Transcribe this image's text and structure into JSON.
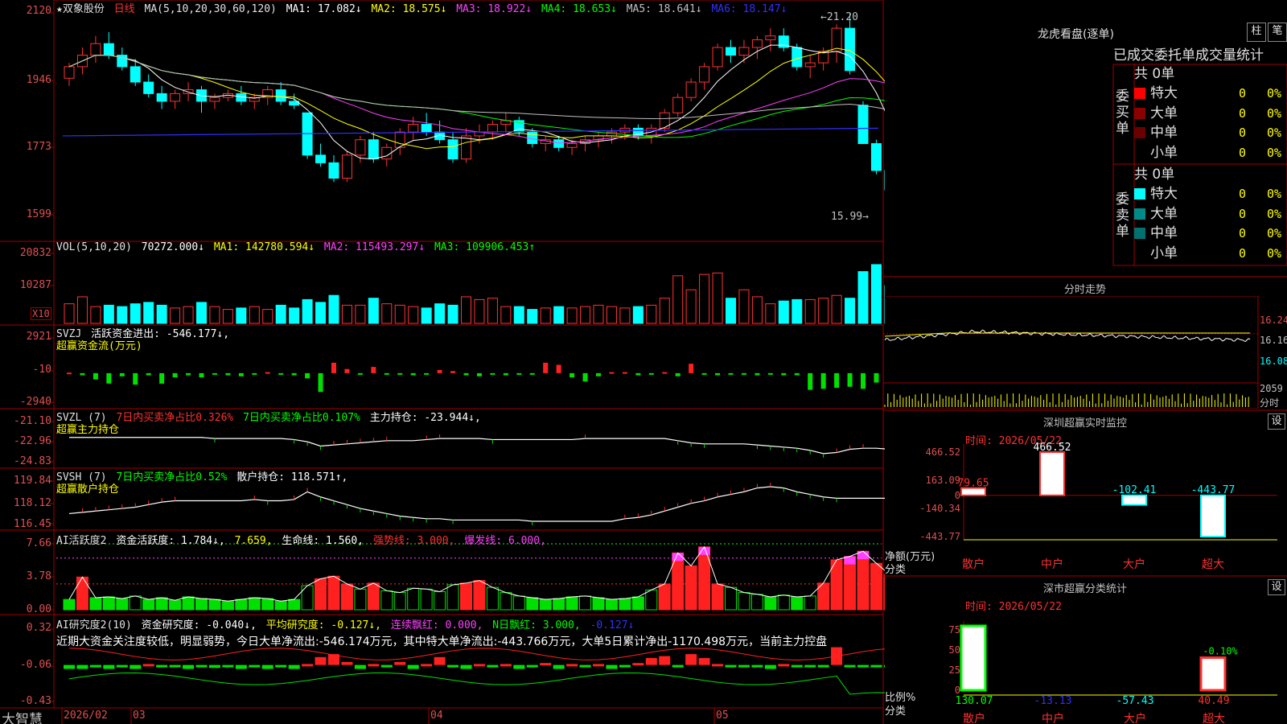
{
  "main_header": {
    "stock_name": "★双象股份",
    "period": "日线",
    "ma_label": "MA(5,10,20,30,60,120)",
    "ma1": "MA1: 17.082↓",
    "ma2": "MA2: 18.575↓",
    "ma3": "MA3: 18.922↓",
    "ma4": "MA4: 18.653↓",
    "ma5": "MA5: 18.641↓",
    "ma6": "MA6: 18.147↓",
    "high_mark": "←21.20",
    "low_mark": "15.99→",
    "y_ticks": [
      "2120",
      "1946",
      "1773",
      "1599"
    ]
  },
  "vol_header": {
    "name": "VOL(5,10,20)",
    "value": "70272.000↓",
    "ma1": "MA1: 142780.594↓",
    "ma2": "MA2: 115493.297↓",
    "ma3": "MA3: 109906.453↑",
    "y_ticks": [
      "20832",
      "10287"
    ],
    "unit": "X10"
  },
  "svzj_header": {
    "name": "SVZJ",
    "active_label": "活跃资金进出: -546.177↓,",
    "sub": "超赢资金流(万元)",
    "y_ticks": [
      "2921",
      "-10",
      "-2940"
    ]
  },
  "svzl_header": {
    "name": "SVZL (7)",
    "t1": "7日内买卖净占比0.326%",
    "t2": "7日内买卖净占比0.107%",
    "t3": "主力持仓: -23.944↓,",
    "sub": "超赢主力持仓",
    "y_ticks": [
      "-21.10",
      "-22.96",
      "-24.83"
    ]
  },
  "svsh_header": {
    "name": "SVSH (7)",
    "t1": "7日内买卖净占比0.52%",
    "t2": "散户持仓: 118.571↑,",
    "sub": "超赢散户持仓",
    "y_ticks": [
      "119.84",
      "118.12",
      "116.45"
    ]
  },
  "ai_active_header": {
    "name": "AI活跃度2",
    "t1": "资金活跃度: 1.784↓,",
    "t2": "7.659,",
    "t3": "生命线: 1.560,",
    "t4": "强势线: 3.000,",
    "t5": "爆发线: 6.000,",
    "y_ticks": [
      "7.66",
      "3.78",
      "0.00"
    ]
  },
  "ai_research_header": {
    "name": "AI研究度2(10)",
    "t1": "资金研究度: -0.040↓,",
    "t2": "平均研究度: -0.127↓,",
    "t3": "连续飘红: 0.000,",
    "t4": "N日飘红: 3.000,",
    "t5": "-0.127↓",
    "comment": "近期大资金关注度较低，明显弱势，今日大单净流出:-546.174万元，其中特大单净流出:-443.766万元，大单5日累计净出-1170.498万元，当前主力控盘",
    "y_ticks": [
      "0.32",
      "-0.06",
      "-0.43"
    ]
  },
  "x_axis": {
    "app_name": "大智慧",
    "labels": [
      "2026/02",
      "03",
      "04",
      "05"
    ]
  },
  "right_panel": {
    "lhkp_title": "龙虎看盘(逐单)",
    "btn_zhu": "柱",
    "btn_bi": "笔",
    "col_headers": "已成交委托单成交量统计",
    "buy_title": "委买单",
    "sell_title": "委卖单",
    "buy_total": "共 0单",
    "sell_total": "共 0单",
    "buy_rows": [
      {
        "label": "特大",
        "count": "0",
        "pct": "0%",
        "color": "#ff0000"
      },
      {
        "label": "大单",
        "count": "0",
        "pct": "0%",
        "color": "#8b0000"
      },
      {
        "label": "中单",
        "count": "0",
        "pct": "0%",
        "color": "#6b0000"
      },
      {
        "label": "小单",
        "count": "0",
        "pct": "0%",
        "color": ""
      }
    ],
    "sell_rows": [
      {
        "label": "特大",
        "count": "0",
        "pct": "0%",
        "color": "#00ffff"
      },
      {
        "label": "大单",
        "count": "0",
        "pct": "0%",
        "color": "#008b8b"
      },
      {
        "label": "中单",
        "count": "0",
        "pct": "0%",
        "color": "#007070"
      },
      {
        "label": "小单",
        "count": "0",
        "pct": "0%",
        "color": ""
      }
    ],
    "intraday_title": "分时走势",
    "intraday_ticks": [
      "16.24",
      "16.16",
      "16.08"
    ],
    "intraday_vol": "2059",
    "intraday_vol_unit": "分时",
    "monitor_title": "深圳超赢实时监控",
    "monitor_btn": "设",
    "monitor_time": "时间: 2026/05/22",
    "monitor_yticks": [
      "466.52",
      "163.09",
      "0",
      "-140.34",
      "-443.77"
    ],
    "monitor_ylabel": "净额(万元)",
    "monitor_xlabel": "分类",
    "monitor_values": [
      "79.65",
      "466.52",
      "-102.41",
      "-443.77"
    ],
    "categories": [
      "散户",
      "中户",
      "大户",
      "超大"
    ],
    "stat_title": "深市超赢分类统计",
    "stat_btn": "设",
    "stat_time": "时间: 2026/05/22",
    "stat_yticks": [
      "75",
      "50",
      "25",
      "0"
    ],
    "stat_ylabel": "比例%",
    "stat_xlabel": "分类",
    "stat_values": [
      "130.07",
      "-13.13",
      "-57.43",
      "40.49"
    ],
    "stat_bar_label": "-0.10%"
  },
  "chart_data": [
    {
      "type": "candlestick",
      "title": "双象股份 日线",
      "ylim": [
        15.99,
        21.2
      ],
      "y_ticks": [
        21.2,
        19.46,
        17.73,
        15.99
      ],
      "ohlc": [
        [
          19.5,
          19.9,
          19.3,
          19.8
        ],
        [
          19.8,
          20.3,
          19.6,
          20.1
        ],
        [
          20.1,
          20.6,
          19.9,
          20.4
        ],
        [
          20.4,
          20.7,
          20.0,
          20.1
        ],
        [
          20.1,
          20.3,
          19.7,
          19.8
        ],
        [
          19.8,
          20.0,
          19.3,
          19.4
        ],
        [
          19.4,
          19.6,
          19.0,
          19.1
        ],
        [
          19.1,
          19.3,
          18.7,
          18.9
        ],
        [
          18.9,
          19.2,
          18.7,
          19.1
        ],
        [
          19.1,
          19.4,
          18.9,
          19.2
        ],
        [
          19.2,
          19.3,
          18.6,
          18.9
        ],
        [
          18.9,
          19.1,
          18.7,
          19.0
        ],
        [
          19.0,
          19.2,
          18.9,
          19.1
        ],
        [
          19.1,
          19.3,
          18.8,
          18.9
        ],
        [
          18.9,
          19.1,
          18.7,
          19.0
        ],
        [
          19.0,
          19.3,
          18.8,
          19.2
        ],
        [
          19.2,
          19.4,
          18.8,
          18.9
        ],
        [
          18.9,
          19.1,
          18.7,
          18.8
        ],
        [
          18.6,
          18.6,
          17.4,
          17.5
        ],
        [
          17.5,
          17.8,
          17.2,
          17.3
        ],
        [
          17.3,
          17.5,
          16.8,
          16.9
        ],
        [
          16.9,
          17.6,
          16.8,
          17.5
        ],
        [
          17.5,
          18.0,
          17.3,
          17.9
        ],
        [
          17.9,
          18.1,
          17.3,
          17.4
        ],
        [
          17.4,
          17.8,
          17.2,
          17.7
        ],
        [
          17.7,
          18.2,
          17.5,
          18.1
        ],
        [
          18.1,
          18.5,
          17.9,
          18.3
        ],
        [
          18.3,
          18.6,
          18.0,
          18.1
        ],
        [
          18.1,
          18.4,
          17.8,
          17.9
        ],
        [
          17.9,
          18.1,
          17.3,
          17.4
        ],
        [
          17.4,
          18.2,
          17.3,
          18.0
        ],
        [
          18.0,
          18.3,
          17.8,
          18.1
        ],
        [
          18.1,
          18.4,
          17.9,
          18.3
        ],
        [
          18.3,
          18.6,
          18.1,
          18.4
        ],
        [
          18.4,
          18.5,
          18.0,
          18.1
        ],
        [
          18.1,
          18.2,
          17.7,
          17.8
        ],
        [
          17.8,
          18.0,
          17.6,
          17.9
        ],
        [
          17.9,
          18.0,
          17.6,
          17.7
        ],
        [
          17.7,
          17.9,
          17.5,
          17.8
        ],
        [
          17.8,
          18.0,
          17.6,
          17.9
        ],
        [
          17.9,
          18.1,
          17.7,
          18.0
        ],
        [
          18.0,
          18.2,
          17.8,
          18.1
        ],
        [
          18.1,
          18.3,
          17.9,
          18.2
        ],
        [
          18.2,
          18.3,
          17.9,
          18.0
        ],
        [
          18.0,
          18.3,
          17.8,
          18.2
        ],
        [
          18.2,
          18.7,
          18.1,
          18.6
        ],
        [
          18.6,
          19.1,
          18.5,
          19.0
        ],
        [
          19.0,
          19.5,
          18.9,
          19.4
        ],
        [
          19.4,
          19.9,
          19.2,
          19.8
        ],
        [
          19.8,
          20.4,
          19.7,
          20.3
        ],
        [
          20.3,
          20.5,
          19.9,
          20.1
        ],
        [
          20.1,
          20.5,
          19.9,
          20.3
        ],
        [
          20.3,
          20.6,
          20.0,
          20.5
        ],
        [
          20.5,
          20.8,
          20.2,
          20.6
        ],
        [
          20.6,
          20.8,
          20.2,
          20.3
        ],
        [
          20.3,
          20.4,
          19.7,
          19.8
        ],
        [
          19.8,
          20.1,
          19.5,
          19.9
        ],
        [
          19.9,
          20.3,
          19.7,
          20.2
        ],
        [
          20.2,
          20.9,
          19.9,
          20.8
        ],
        [
          20.8,
          21.2,
          19.6,
          19.7
        ],
        [
          18.8,
          18.9,
          17.8,
          17.8
        ],
        [
          17.8,
          17.9,
          17.0,
          17.1
        ],
        [
          17.1,
          17.2,
          16.5,
          16.6
        ],
        [
          16.6,
          16.7,
          16.1,
          16.2
        ],
        [
          16.2,
          16.3,
          15.99,
          16.1
        ]
      ]
    },
    {
      "type": "bar",
      "title": "VOL",
      "ylim": [
        0,
        25000
      ],
      "values": [
        7000,
        9500,
        6000,
        6500,
        6000,
        7000,
        7500,
        6500,
        5500,
        6000,
        7500,
        6000,
        5000,
        5500,
        6000,
        5000,
        6500,
        5500,
        8500,
        7500,
        10000,
        6500,
        6500,
        9000,
        7000,
        6500,
        6000,
        5500,
        7000,
        6500,
        9500,
        8500,
        9000,
        6000,
        6000,
        5000,
        5500,
        6000,
        5500,
        6000,
        6500,
        6000,
        5500,
        6000,
        6500,
        9000,
        17000,
        12000,
        17500,
        18000,
        9000,
        12000,
        9500,
        7000,
        8000,
        8500,
        8500,
        9000,
        10000,
        9000,
        18500,
        21000,
        13500,
        12000,
        7027
      ]
    },
    {
      "type": "bar",
      "title": "超赢资金流(万元)",
      "ylim": [
        -2940,
        2921
      ],
      "values": [
        50,
        -200,
        -600,
        -1000,
        -300,
        -1100,
        -200,
        -1000,
        -400,
        -200,
        -400,
        -100,
        -200,
        -300,
        -100,
        100,
        -100,
        -200,
        -500,
        -1800,
        1000,
        400,
        -100,
        600,
        -100,
        -100,
        -200,
        -100,
        300,
        200,
        -200,
        -300,
        -100,
        -200,
        -100,
        -100,
        1000,
        800,
        -400,
        -800,
        -300,
        100,
        100,
        -200,
        -100,
        100,
        -300,
        900,
        -100,
        -200,
        -100,
        -100,
        -200,
        -100,
        -200,
        -200,
        -1600,
        -1500,
        -1400,
        -1300,
        -1500,
        -900,
        -400,
        -100,
        -1500,
        -2300,
        2100,
        -400,
        -200,
        -200,
        -100,
        -400
      ]
    },
    {
      "type": "line",
      "title": "超赢主力持仓",
      "ylim": [
        -24.83,
        -21.1
      ],
      "values": [
        -22.5,
        -22.5,
        -22.5,
        -22.5,
        -22.5,
        -22.5,
        -22.5,
        -22.5,
        -22.5,
        -22.5,
        -22.5,
        -22.6,
        -22.6,
        -22.6,
        -22.6,
        -22.6,
        -22.6,
        -22.7,
        -22.9,
        -23.3,
        -23.2,
        -23.1,
        -23.0,
        -22.9,
        -22.8,
        -22.8,
        -22.8,
        -22.7,
        -22.6,
        -22.6,
        -22.6,
        -22.6,
        -22.7,
        -22.7,
        -22.7,
        -22.7,
        -22.7,
        -22.7,
        -22.7,
        -22.6,
        -22.6,
        -22.6,
        -22.6,
        -22.6,
        -22.6,
        -22.6,
        -22.8,
        -23.0,
        -23.1,
        -23.1,
        -23.1,
        -23.1,
        -23.2,
        -23.3,
        -23.4,
        -23.5,
        -23.7,
        -24.0,
        -23.9,
        -23.6,
        -23.5,
        -23.5,
        -23.6,
        -23.8,
        -23.9
      ]
    },
    {
      "type": "line",
      "title": "超赢散户持仓",
      "ylim": [
        116.45,
        119.84
      ],
      "values": [
        117.3,
        117.4,
        117.5,
        117.6,
        117.7,
        117.8,
        118.0,
        118.2,
        118.3,
        118.3,
        118.3,
        118.3,
        118.3,
        118.3,
        118.4,
        118.3,
        118.3,
        118.4,
        119.0,
        118.6,
        118.3,
        118.0,
        117.7,
        117.5,
        117.3,
        117.1,
        117.0,
        116.9,
        116.9,
        116.8,
        116.8,
        116.8,
        116.8,
        116.8,
        116.8,
        116.7,
        116.7,
        116.7,
        116.7,
        116.7,
        116.7,
        116.7,
        116.9,
        117.0,
        117.2,
        117.5,
        117.8,
        118.1,
        118.3,
        118.6,
        118.8,
        119.0,
        119.3,
        119.4,
        119.3,
        119.0,
        118.8,
        118.6,
        118.5,
        118.5,
        118.5,
        118.5,
        118.5,
        118.6,
        118.6
      ]
    },
    {
      "type": "bar",
      "title": "AI活跃度2",
      "ylim": [
        0,
        7.66
      ],
      "values": [
        1.2,
        3.8,
        1.4,
        1.5,
        1.3,
        1.6,
        1.2,
        1.4,
        1.1,
        1.5,
        1.3,
        1.2,
        1.0,
        1.2,
        1.4,
        1.3,
        1.0,
        1.2,
        2.8,
        3.6,
        3.9,
        3.0,
        2.4,
        3.1,
        2.2,
        2.0,
        2.5,
        2.4,
        2.1,
        2.9,
        3.1,
        3.4,
        2.6,
        2.0,
        1.6,
        1.4,
        1.2,
        1.3,
        1.5,
        1.6,
        1.4,
        1.2,
        1.3,
        1.5,
        2.3,
        3.0,
        6.6,
        5.1,
        7.3,
        3.0,
        2.6,
        2.0,
        1.8,
        1.5,
        1.7,
        1.5,
        1.6,
        3.1,
        5.8,
        6.2,
        6.8,
        5.4,
        4.1,
        2.7,
        1.8
      ]
    },
    {
      "type": "bar",
      "title": "AI研究度2(10)",
      "ylim": [
        -0.43,
        0.32
      ],
      "values": [
        -0.1,
        -0.1,
        -0.06,
        -0.1,
        -0.07,
        -0.1,
        -0.05,
        -0.08,
        -0.06,
        -0.1,
        -0.07,
        -0.09,
        -0.06,
        -0.1,
        -0.08,
        -0.1,
        -0.06,
        -0.1,
        -0.05,
        0.02,
        0.05,
        -0.03,
        -0.1,
        -0.05,
        -0.08,
        -0.03,
        -0.1,
        -0.05,
        0.02,
        -0.06,
        -0.1,
        -0.05,
        -0.08,
        -0.05,
        -0.1,
        -0.06,
        -0.04,
        -0.1,
        -0.05,
        -0.08,
        -0.05,
        -0.1,
        -0.06,
        -0.04,
        0.01,
        0.03,
        -0.06,
        0.05,
        0.01,
        -0.05,
        -0.06,
        -0.08,
        -0.06,
        -0.1,
        -0.05,
        -0.07,
        -0.08,
        -0.06,
        0.12,
        -0.06,
        -0.06,
        -0.06,
        -0.06,
        -0.06,
        -0.06
      ]
    },
    {
      "type": "bar",
      "title": "深圳超赢实时监控",
      "categories": [
        "散户",
        "中户",
        "大户",
        "超大"
      ],
      "values": [
        79.65,
        466.52,
        -102.41,
        -443.77
      ],
      "ylabel": "净额(万元)",
      "xlabel": "分类",
      "ylim": [
        -443.77,
        466.52
      ]
    },
    {
      "type": "bar",
      "title": "深市超赢分类统计",
      "categories": [
        "散户",
        "中户",
        "大户",
        "超大"
      ],
      "values": [
        130.07,
        -13.13,
        -57.43,
        40.49
      ],
      "ylabel": "比例%",
      "xlabel": "分类",
      "ylim": [
        0,
        80
      ]
    }
  ]
}
